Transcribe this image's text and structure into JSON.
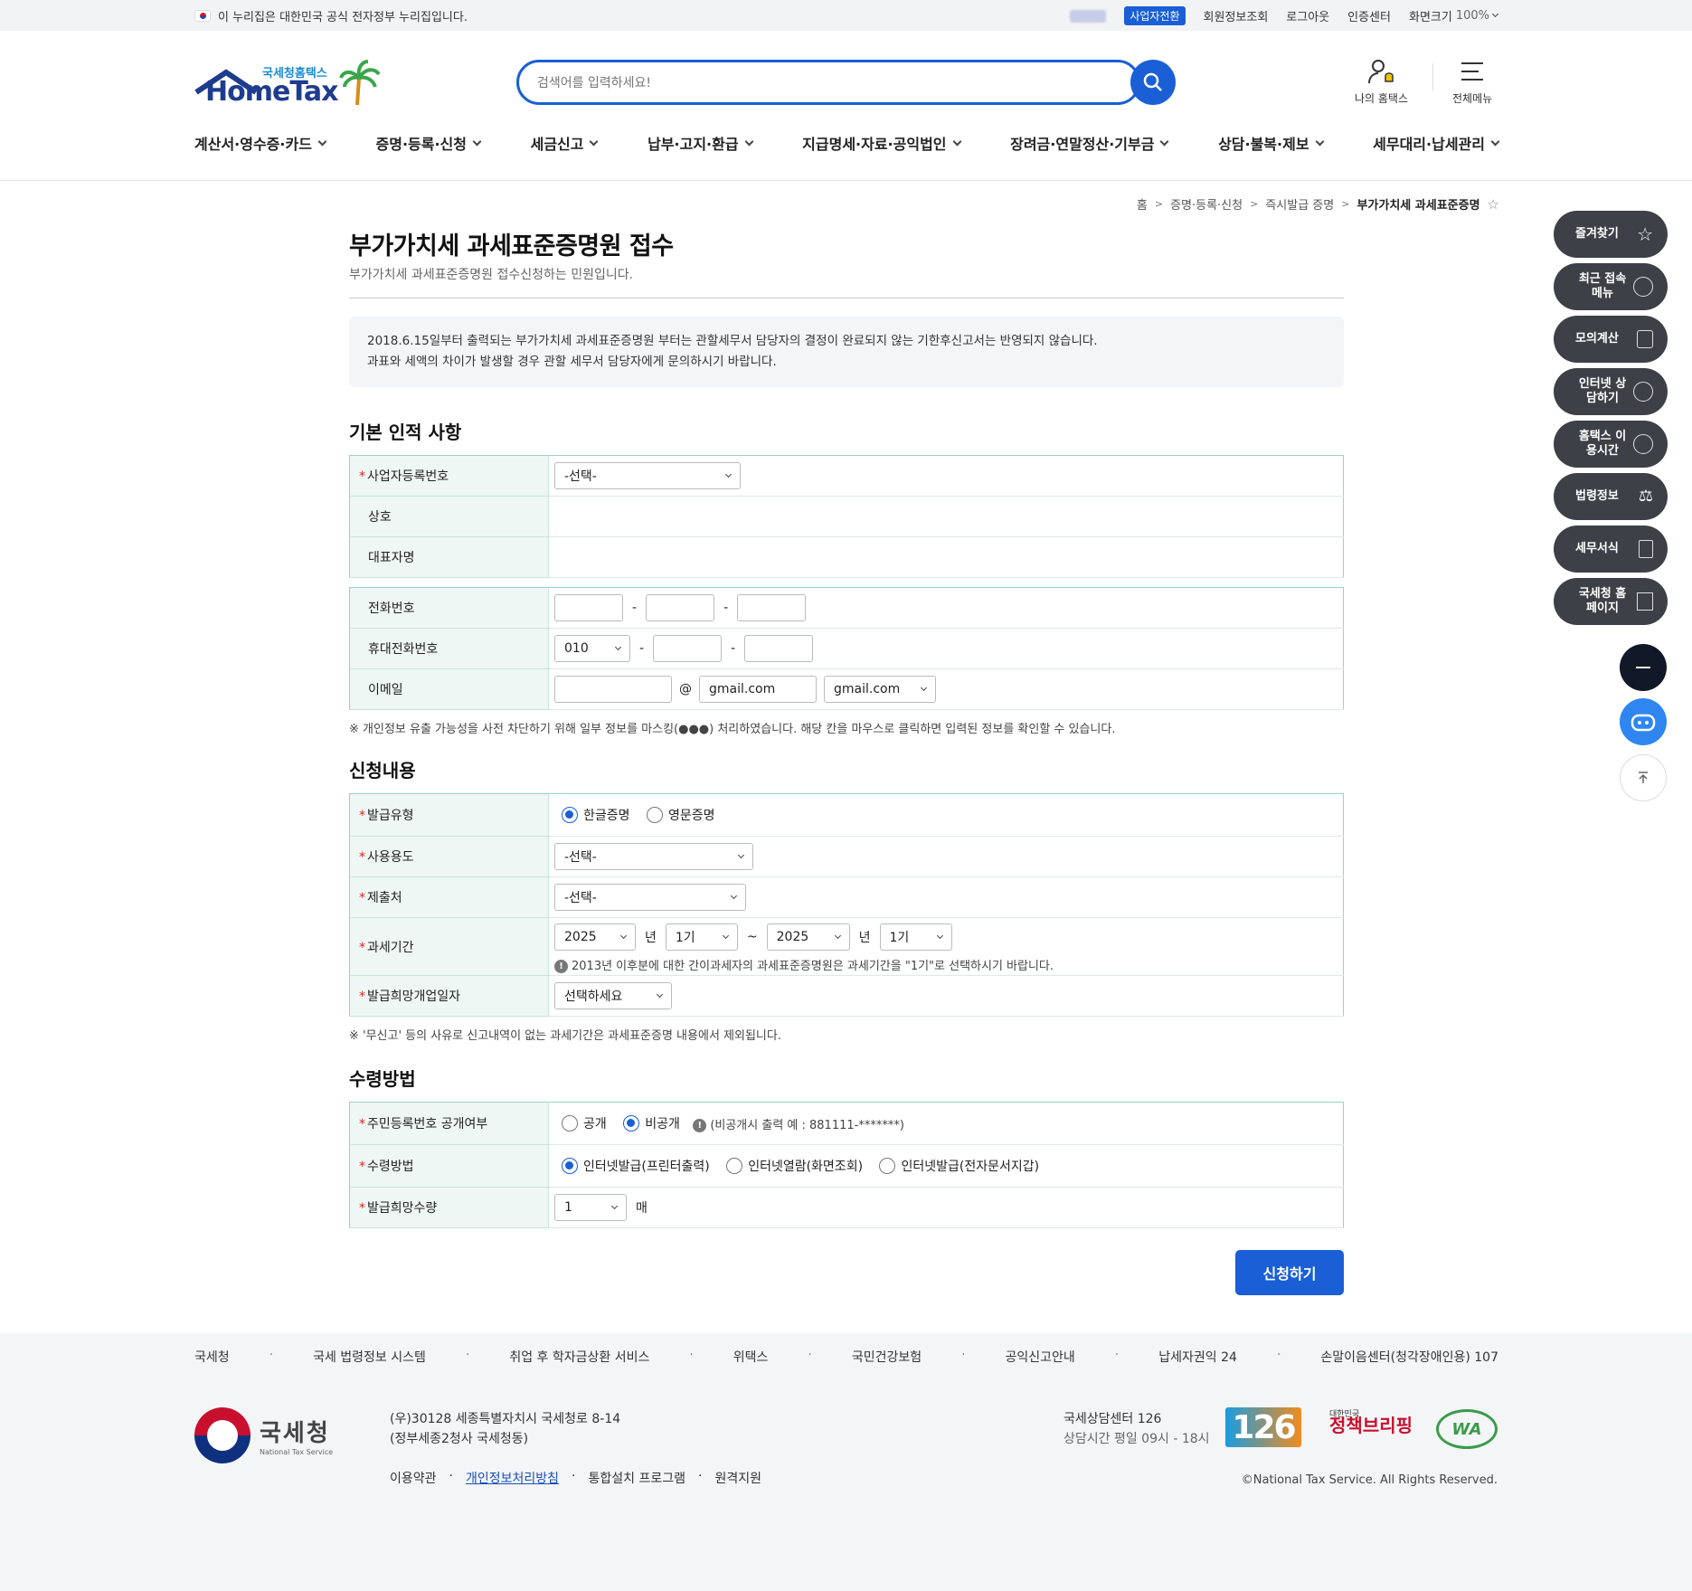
{
  "topbar": {
    "gov_notice": "이 누리집은 대한민국 공식 전자정부 누리집입니다.",
    "biz_switch": "사업자전환",
    "member_info": "회원정보조회",
    "logout": "로그아웃",
    "cert_center": "인증센터",
    "screen_size": "화면크기",
    "zoom": "100%"
  },
  "header": {
    "logo_small": "국세청홈택스",
    "logo_big": "HomeTax",
    "search_placeholder": "검색어를 입력하세요!",
    "my_hometax": "나의 홈택스",
    "all_menu": "전체메뉴"
  },
  "gnb": [
    "계산서·영수증·카드",
    "증명·등록·신청",
    "세금신고",
    "납부·고지·환급",
    "지급명세·자료·공익법인",
    "장려금·연말정산·기부금",
    "상담·불복·제보",
    "세무대리·납세관리"
  ],
  "breadcrumb": [
    "홈",
    "증명·등록·신청",
    "즉시발급 증명",
    "부가가치세 과세표준증명"
  ],
  "quick_menu": [
    {
      "label": "즐겨찾기",
      "icon": "star-icon"
    },
    {
      "label": "최근 접속메뉴",
      "icon": "clock-icon"
    },
    {
      "label": "모의계산",
      "icon": "calculator-icon"
    },
    {
      "label": "인터넷 상담하기",
      "icon": "chat-icon"
    },
    {
      "label": "홈택스 이용시간",
      "icon": "alarm-icon"
    },
    {
      "label": "법령정보",
      "icon": "gavel-icon"
    },
    {
      "label": "세무서식",
      "icon": "form-icon"
    },
    {
      "label": "국세청 홈페이지",
      "icon": "building-icon"
    }
  ],
  "page": {
    "title": "부가가치세 과세표준증명원 접수",
    "subtitle": "부가가치세 과세표준증명원 접수신청하는 민원입니다.",
    "notice1": "2018.6.15일부터 출력되는 부가가치세 과세표준증명원 부터는 관할세무서 담당자의 결정이 완료되지 않는 기한후신고서는 반영되지 않습니다.",
    "notice2": "과표와 세액의 차이가 발생할 경우 관할 세무서 담당자에게 문의하시기 바랍니다."
  },
  "basic": {
    "heading": "기본 인적 사항",
    "biz_no_label": "사업자등록번호",
    "biz_no_value": "-선택-",
    "company_label": "상호",
    "rep_label": "대표자명",
    "phone_label": "전화번호",
    "mobile_label": "휴대전화번호",
    "mobile_prefix": "010",
    "email_label": "이메일",
    "email_at": "@",
    "email_domain": "gmail.com",
    "email_select": "gmail.com",
    "mask_note": "※ 개인정보 유출 가능성을 사전 차단하기 위해 일부 정보를 마스킹(●●●) 처리하였습니다. 해당 칸을 마우스로 클릭하면 입력된 정보를 확인할 수 있습니다."
  },
  "request": {
    "heading": "신청내용",
    "type_label": "발급유형",
    "type_opt1": "한글증명",
    "type_opt2": "영문증명",
    "usage_label": "사용용도",
    "usage_value": "-선택-",
    "submit_to_label": "제출처",
    "submit_to_value": "-선택-",
    "period_label": "과세기간",
    "from_year": "2025",
    "year_unit": "년",
    "from_term": "1기",
    "tilde": "~",
    "to_year": "2025",
    "to_term": "1기",
    "period_note": "2013년 이후분에 대한 간이과세자의 과세표준증명원은 과세기간을 \"1기\"로 선택하시기 바랍니다.",
    "open_date_label": "발급희망개업일자",
    "open_date_value": "선택하세요",
    "exclude_note": "※ '무신고' 등의 사유로 신고내역이 없는 과세기간은 과세표준증명 내용에서 제외됩니다."
  },
  "receive": {
    "heading": "수령방법",
    "rrn_label": "주민등록번호 공개여부",
    "rrn_opt1": "공개",
    "rrn_opt2": "비공개",
    "rrn_note": "(비공개시 출력 예 : 881111-*******)",
    "method_label": "수령방법",
    "method_opt1": "인터넷발급(프린터출력)",
    "method_opt2": "인터넷열람(화면조회)",
    "method_opt3": "인터넷발급(전자문서지갑)",
    "qty_label": "발급희망수량",
    "qty_value": "1",
    "qty_unit": "매"
  },
  "submit_label": "신청하기",
  "footer": {
    "links": [
      "국세청",
      "국세 법령정보 시스템",
      "취업 후 학자금상환 서비스",
      "위택스",
      "국민건강보험",
      "공익신고안내",
      "납세자권익 24",
      "손말이음센터(청각장애인용) 107"
    ],
    "org_kr": "국세청",
    "org_en": "National Tax Service",
    "addr1": "(우)30128 세종특별자치시 국세청로 8-14",
    "addr2": "(정부세종2청사 국세청동)",
    "bottom_links": [
      "이용약관",
      "개인정보처리방침",
      "통합설치 프로그램",
      "원격지원"
    ],
    "center1": "국세상담센터 126",
    "center2": "상담시간 평일 09시 - 18시",
    "badge_126": "126",
    "policy_small": "대한민국",
    "policy_big": "정책브리핑",
    "wa": "WA",
    "copyright": "©National Tax Service. All Rights Reserved."
  }
}
